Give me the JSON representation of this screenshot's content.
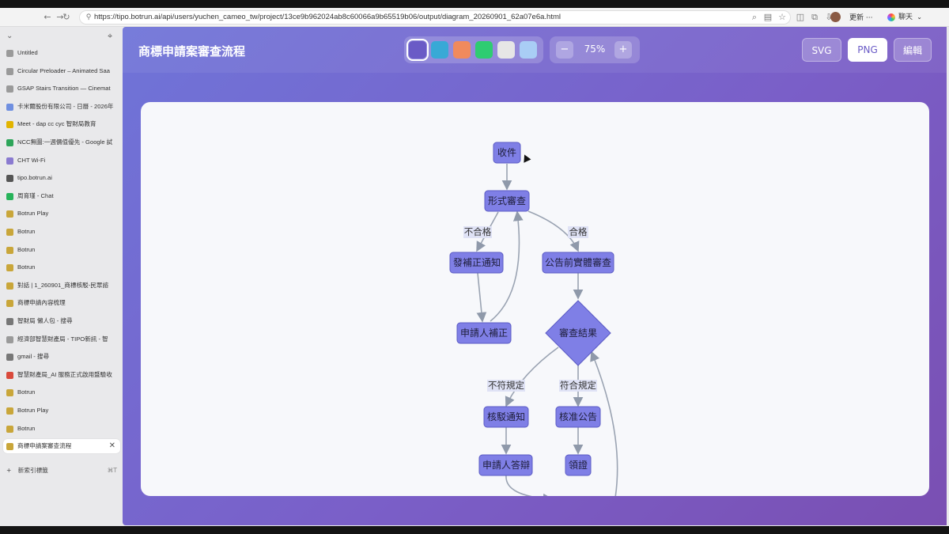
{
  "browser": {
    "url": "https://tipo.botrun.ai/api/users/yuchen_cameo_tw/project/13ce9b962024ab8c60066a9b65519b06/output/diagram_20260901_62a07e6a.html",
    "update_label": "更新 ···",
    "chat_label": "聊天"
  },
  "sidebar": {
    "items": [
      {
        "label": "Untitled",
        "icon": "globe-icon"
      },
      {
        "label": "Circular Preloader – Animated Saa",
        "icon": "globe-icon"
      },
      {
        "label": "GSAP Stairs Transition — Cinemat",
        "icon": "globe-icon"
      },
      {
        "label": "卡米爾股份有限公司 - 日曆 - 2026年",
        "icon": "calendar-icon"
      },
      {
        "label": "Meet - dap cc cyc 智財局教育",
        "icon": "meet-icon"
      },
      {
        "label": "NCC無圖:一週價值優先 - Google 試",
        "icon": "sheet-icon"
      },
      {
        "label": "CHT Wi-Fi",
        "icon": "wifi-icon"
      },
      {
        "label": "tipo.botrun.ai",
        "icon": "lock-icon"
      },
      {
        "label": "周育瑾 - Chat",
        "icon": "chat-icon"
      },
      {
        "label": "Botrun Play",
        "icon": "botrun-icon"
      },
      {
        "label": "Botrun",
        "icon": "botrun-icon"
      },
      {
        "label": "Botrun",
        "icon": "botrun-icon"
      },
      {
        "label": "Botrun",
        "icon": "botrun-icon"
      },
      {
        "label": "對話 | 1_260901_商標核駁-民眾諮",
        "icon": "botrun-icon"
      },
      {
        "label": "商標申請內容梳理",
        "icon": "botrun-icon"
      },
      {
        "label": "智財局 懶人包 - 搜尋",
        "icon": "search-icon"
      },
      {
        "label": "經濟部智慧財產局 - TIPO新訊 - 智",
        "icon": "doc-icon"
      },
      {
        "label": "gmail - 搜尋",
        "icon": "search-icon"
      },
      {
        "label": "智慧財產局_AI 服務正式啟用暨驗收",
        "icon": "gmail-icon"
      },
      {
        "label": "Botrun",
        "icon": "botrun-icon"
      },
      {
        "label": "Botrun Play",
        "icon": "botrun-icon"
      },
      {
        "label": "Botrun",
        "icon": "botrun-icon"
      },
      {
        "label": "商標申請案審查流程",
        "icon": "botrun-icon",
        "active": true
      }
    ],
    "new_tab_label": "新索引標籤",
    "new_tab_shortcut": "⌘T"
  },
  "app": {
    "title": "商標申請案審查流程",
    "zoom": "75%",
    "zoom_minus": "−",
    "zoom_plus": "+",
    "buttons": {
      "svg": "SVG",
      "png": "PNG",
      "edit": "編輯"
    },
    "swatches": [
      "#6a5bc6",
      "#38a9d6",
      "#f08a5d",
      "#2ecc71",
      "#e6e6e6",
      "#a9cdf5"
    ]
  },
  "diagram": {
    "nodes": {
      "receive": "收件",
      "formal": "形式審查",
      "notice_fix": "發補正通知",
      "applicant_fix": "申請人補正",
      "pre_review": "公告前實體審查",
      "result": "審查結果",
      "reject": "核駁通知",
      "approve": "核准公告",
      "defend": "申請人答辯",
      "cert": "領證"
    },
    "edges": {
      "fail": "不合格",
      "pass": "合格",
      "nonconform": "不符規定",
      "conform": "符合規定"
    }
  }
}
